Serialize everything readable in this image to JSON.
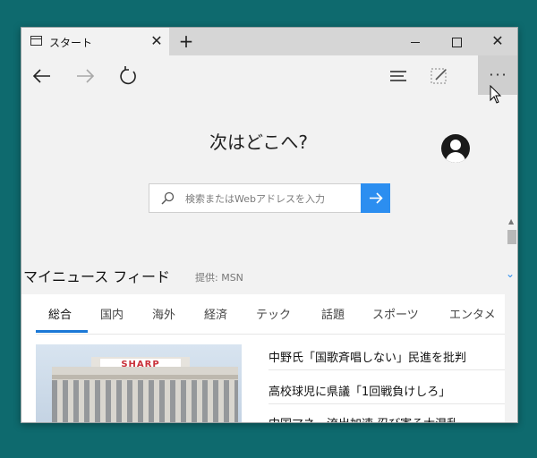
{
  "tab": {
    "title": "スタート"
  },
  "heading": "次はどこへ?",
  "search": {
    "placeholder": "検索またはWebアドレスを入力"
  },
  "feed": {
    "title": "マイニュース フィード",
    "source": "提供: MSN",
    "tabs": [
      "総合",
      "国内",
      "海外",
      "経済",
      "テック",
      "話題",
      "スポーツ",
      "エンタメ"
    ],
    "active_tab": "総合",
    "image_logo_text": "SHARP",
    "headlines": [
      "中野氏「国歌斉唱しない」民進を批判",
      "高校球児に県議「1回戦負けしろ」",
      "中国マネー流出加速 忍び寄る大混乱"
    ]
  },
  "colors": {
    "accent": "#2c8ef0",
    "tab_underline": "#1b78d6",
    "desktop": "#0e6a6e"
  }
}
